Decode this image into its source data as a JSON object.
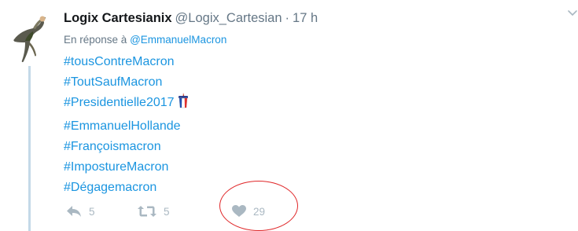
{
  "tweet": {
    "display_name": "Logix Cartesianix",
    "handle": "@Logix_Cartesian",
    "separator": "·",
    "time": "17 h",
    "reply_prefix": "En réponse à",
    "reply_to": "@EmmanuelMacron",
    "hashtags": [
      "#tousContreMacron",
      "#ToutSaufMacron",
      "#Presidentielle2017",
      "#EmmanuelHollande",
      "#Françoismacron",
      "#ImpostureMacron",
      "#Dégagemacron"
    ],
    "actions": {
      "reply_count": "5",
      "retweet_count": "5",
      "like_count": "29"
    }
  },
  "icons": {
    "reply": "reply-arrow-icon",
    "retweet": "retweet-icon",
    "like": "heart-icon",
    "more": "chevron-down-icon",
    "emoji": "french-flag-cup-icon"
  },
  "colors": {
    "link": "#1b95e0",
    "text": "#14171a",
    "muted": "#657786",
    "action": "#aab8c2",
    "thread": "#c4d9e8",
    "annotation": "#e0282a"
  }
}
